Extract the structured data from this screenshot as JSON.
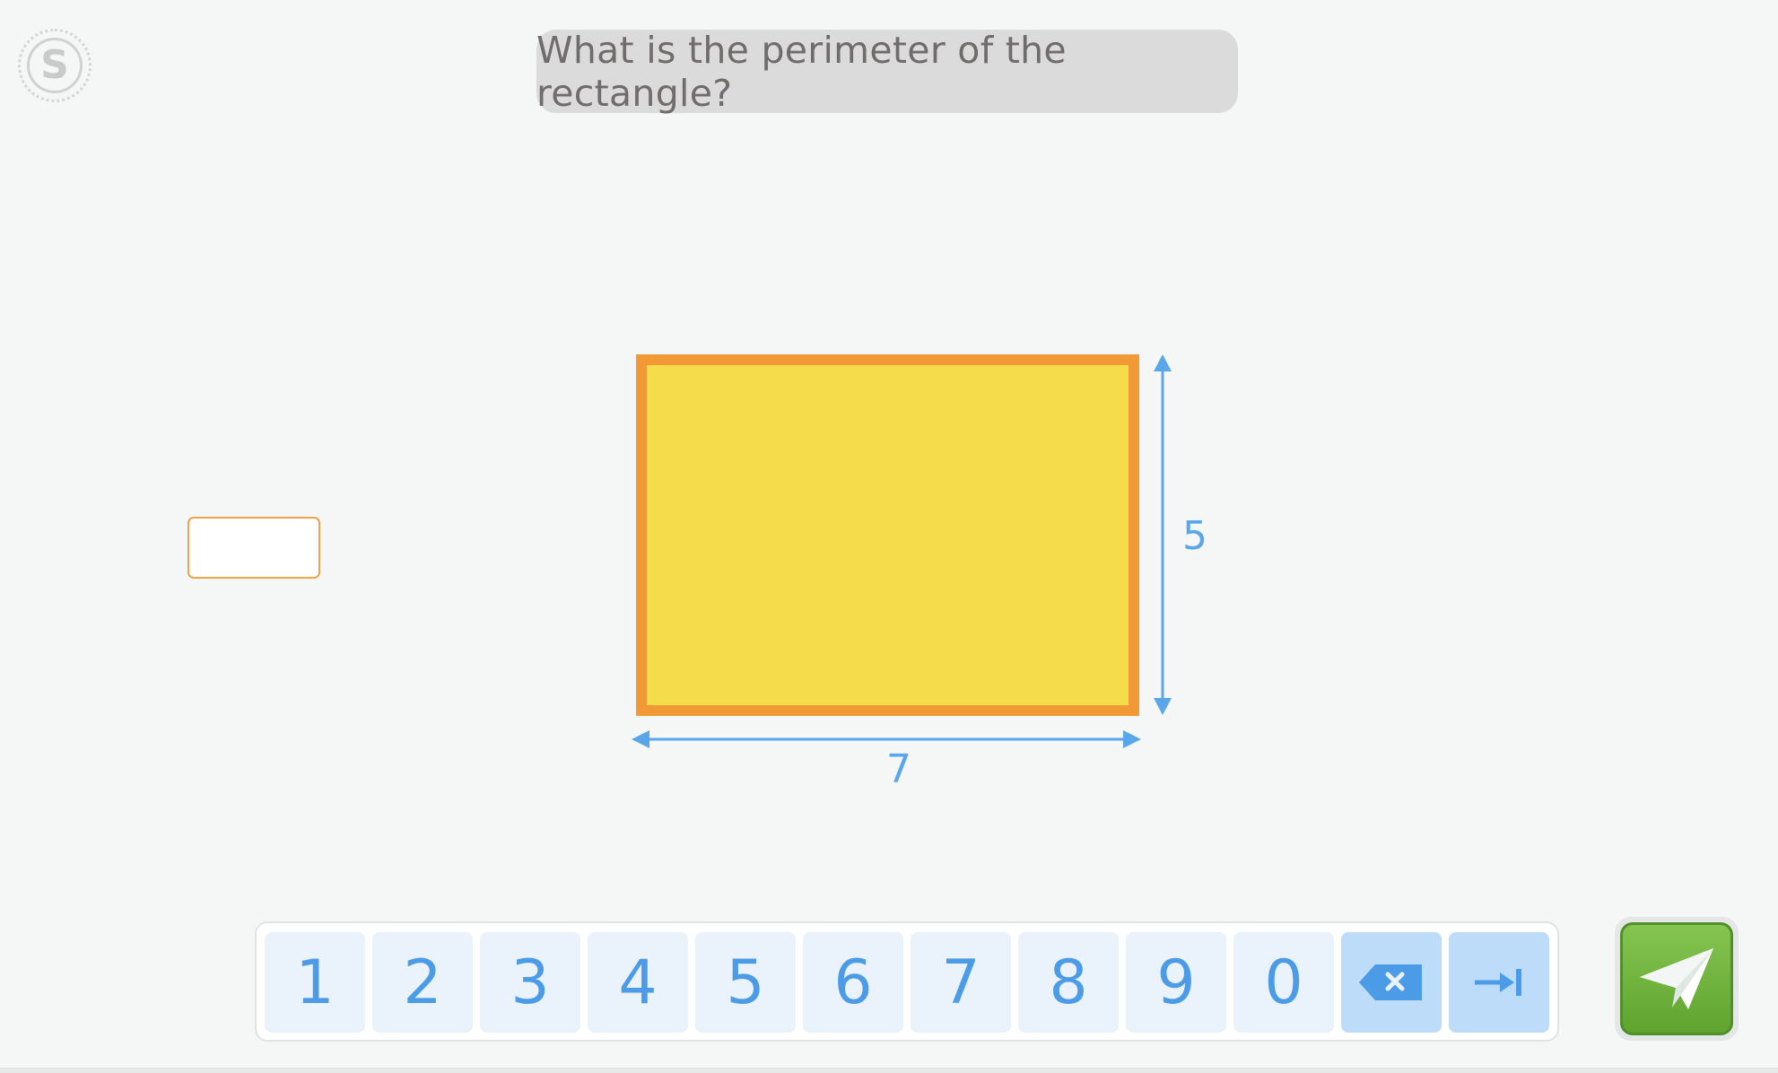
{
  "logo": {
    "letter": "S",
    "icon": "s-logo-icon"
  },
  "question": {
    "text": "What is the perimeter of the rectangle?"
  },
  "answer_input": {
    "value": ""
  },
  "diagram": {
    "width_label": "7",
    "height_label": "5",
    "fill_color": "#f5dc4a",
    "border_color": "#f19a35",
    "arrow_color": "#5aa6ea"
  },
  "keypad": {
    "keys": [
      "1",
      "2",
      "3",
      "4",
      "5",
      "6",
      "7",
      "8",
      "9",
      "0"
    ],
    "backspace_icon": "backspace-icon",
    "tab_icon": "tab-arrow-icon"
  },
  "submit": {
    "icon": "paper-plane-icon",
    "color": "#6db33f"
  }
}
